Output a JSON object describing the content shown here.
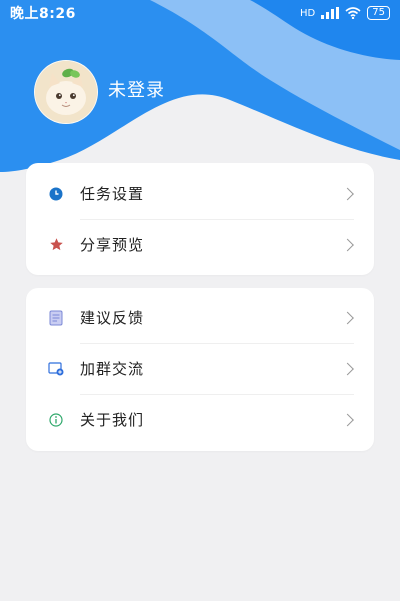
{
  "status_bar": {
    "time": "晚上8:26",
    "signal_text": "HD",
    "battery": "75"
  },
  "profile": {
    "avatar_icon": "cat-avatar",
    "login_text": "未登录"
  },
  "menu_group_1": [
    {
      "label": "任务设置",
      "icon": "clock-icon",
      "icon_color": "#1a73c9"
    },
    {
      "label": "分享预览",
      "icon": "star-icon",
      "icon_color": "#c9524e"
    }
  ],
  "menu_group_2": [
    {
      "label": "建议反馈",
      "icon": "feedback-icon",
      "icon_color": "#7b88d6"
    },
    {
      "label": "加群交流",
      "icon": "add-group-icon",
      "icon_color": "#2f6fdc"
    },
    {
      "label": "关于我们",
      "icon": "info-icon",
      "icon_color": "#2fa86b"
    }
  ],
  "colors": {
    "header_dark_blue": "#1f86ee",
    "header_light_blue": "#8cc0f6",
    "page_background": "#f0f0f2"
  }
}
